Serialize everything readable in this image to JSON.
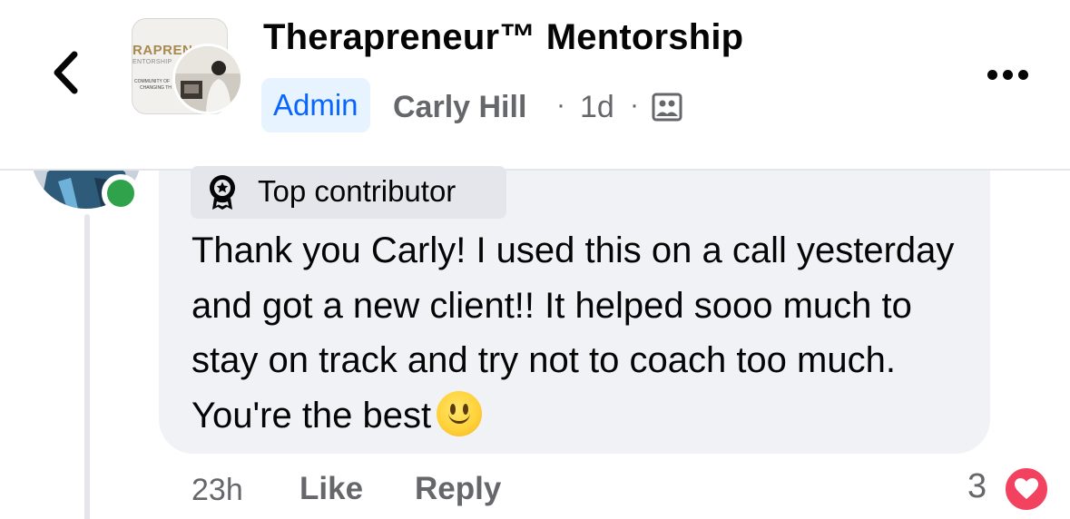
{
  "header": {
    "back_icon": "chevron-left-icon",
    "group_title": "Therapreneur™ Mentorship",
    "group_thumbnail": {
      "brand_text": "RAPREN",
      "sub_text": "ENTORSHIP",
      "line1": "COMMUNITY OF",
      "line2": "CHANGING TH"
    },
    "admin_badge": "Admin",
    "author_name": "Carly Hill",
    "separator": "·",
    "post_time": "1d",
    "privacy_icon": "group-members-icon",
    "more_icon": "more-horizontal-icon"
  },
  "comment": {
    "badge_icon": "award-ribbon-icon",
    "badge_label": "Top contributor",
    "text": "Thank you Carly! I used this on a call yesterday and got a new client!! It helped sooo much to stay on track and try not to coach too much. You're the best",
    "emoji": "slightly-smiling-face",
    "online_status": "online",
    "time": "23h",
    "like_label": "Like",
    "reply_label": "Reply",
    "reaction_count": "3",
    "reaction_icon": "love-heart-icon"
  },
  "colors": {
    "accent": "#0866ff",
    "admin_badge_bg": "#e7f3ff",
    "bubble_bg": "#f0f2f5",
    "secondary_text": "#65676b",
    "online_green": "#31a24c",
    "love_red": "#f3425f"
  }
}
